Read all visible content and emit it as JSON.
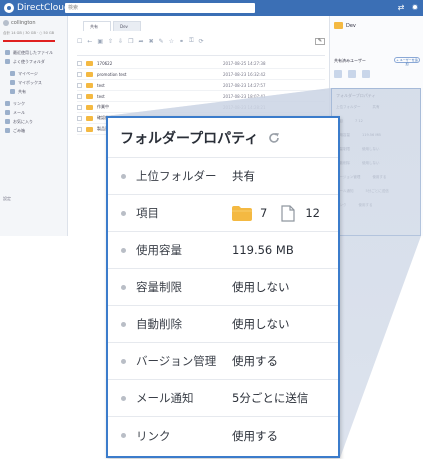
{
  "app": {
    "logo_text": "DirectCloud",
    "search_placeholder": "検索"
  },
  "sidebar": {
    "user_name": "collington",
    "storage_text": "合計 14 GB / 30 GB  ·  ○  50 GB",
    "items": [
      {
        "label": "最近使用したファイル"
      },
      {
        "label": "よく使うフォルダ"
      },
      {
        "label": "マイページ",
        "sub": true
      },
      {
        "label": "マイボックス",
        "sub": true
      },
      {
        "label": "共有",
        "sub": true
      },
      {
        "label": "リンク"
      },
      {
        "label": "メール"
      },
      {
        "label": "お気に入り"
      },
      {
        "label": "ごみ箱"
      }
    ],
    "settings_label": "設定"
  },
  "main": {
    "tabs": [
      {
        "label": "共有"
      },
      {
        "label": "Dev"
      }
    ],
    "rows": [
      {
        "name": "170622",
        "owner": "",
        "date": "2017-08-25 14:27:38"
      },
      {
        "name": "promotion test",
        "owner": "",
        "date": "2017-08-23 16:32:42"
      },
      {
        "name": "test",
        "owner": "",
        "date": "2017-08-23 14:27:57"
      },
      {
        "name": "test",
        "owner": "",
        "date": "2017-08-23 18:07:41"
      },
      {
        "name": "作業中",
        "owner": "",
        "date": "2017-08-23 14:28:21"
      },
      {
        "name": "確認依頼",
        "owner": "",
        "date": "2017-08-23 14:28:21"
      },
      {
        "name": "製品資料",
        "owner": "",
        "date": "2017-08-24 10:34:09"
      }
    ]
  },
  "right_panel": {
    "folder_name": "Dev",
    "shared_users_label": "共有済みユーザー",
    "add_user_label": "+ ユーザーを追加",
    "prop_title": "フォルダープロパティ",
    "mini_rows": [
      {
        "label": "上位フォルダー",
        "value": "共有"
      },
      {
        "label": "項目",
        "value": "7 12"
      },
      {
        "label": "使用容量",
        "value": "119.56 MB"
      },
      {
        "label": "容量制限",
        "value": "使用しない"
      },
      {
        "label": "自動削除",
        "value": "使用しない"
      },
      {
        "label": "バージョン管理",
        "value": "使用する"
      },
      {
        "label": "メール通知",
        "value": "5分ごとに送信"
      },
      {
        "label": "リンク",
        "value": "使用する"
      }
    ]
  },
  "callout": {
    "title": "フォルダープロパティ",
    "rows": [
      {
        "label": "上位フォルダー",
        "value": "共有"
      },
      {
        "label": "項目",
        "folder_count": "7",
        "file_count": "12"
      },
      {
        "label": "使用容量",
        "value": "119.56 MB"
      },
      {
        "label": "容量制限",
        "value": "使用しない"
      },
      {
        "label": "自動削除",
        "value": "使用しない"
      },
      {
        "label": "バージョン管理",
        "value": "使用する"
      },
      {
        "label": "メール通知",
        "value": "5分ごとに送信"
      },
      {
        "label": "リンク",
        "value": "使用する"
      }
    ]
  },
  "colors": {
    "brand": "#3b6fb5",
    "highlight_border": "#3b7ccb",
    "folder": "#f4b942",
    "alert": "#e02020"
  }
}
